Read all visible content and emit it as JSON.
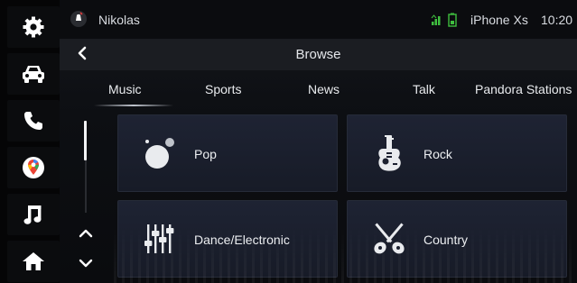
{
  "colors": {
    "accent": "#f2f3f5",
    "tile_bg": "#1c2130",
    "signal_green": "#3fbf3f"
  },
  "rail": [
    {
      "icon": "gear-icon"
    },
    {
      "icon": "car-icon"
    },
    {
      "icon": "phone-icon"
    },
    {
      "icon": "maps-icon"
    },
    {
      "icon": "music-note-icon"
    },
    {
      "icon": "home-icon"
    }
  ],
  "status": {
    "user": "Nikolas",
    "device": "iPhone Xs",
    "time": "10:20"
  },
  "header": {
    "title": "Browse"
  },
  "tabs": [
    {
      "label": "Music",
      "selected": true
    },
    {
      "label": "Sports"
    },
    {
      "label": "News"
    },
    {
      "label": "Talk"
    },
    {
      "label": "Pandora Stations"
    }
  ],
  "tiles": [
    {
      "label": "Pop",
      "icon": "pop-bubbles-icon"
    },
    {
      "label": "Rock",
      "icon": "electric-guitar-icon"
    },
    {
      "label": "Dance/Electronic",
      "icon": "equalizer-sliders-icon"
    },
    {
      "label": "Country",
      "icon": "crossed-guitars-icon"
    }
  ],
  "scroll": {
    "position": 0.0
  }
}
